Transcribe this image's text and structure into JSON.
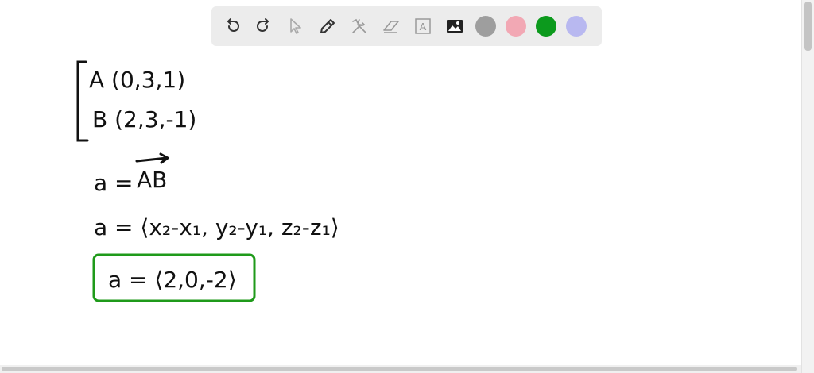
{
  "toolbar": {
    "tools": [
      {
        "name": "undo-icon"
      },
      {
        "name": "redo-icon"
      },
      {
        "name": "pointer-icon"
      },
      {
        "name": "pen-icon"
      },
      {
        "name": "tools-icon"
      },
      {
        "name": "eraser-icon"
      },
      {
        "name": "text-icon",
        "glyph": "A"
      },
      {
        "name": "image-icon"
      }
    ],
    "colors": [
      "#9e9e9e",
      "#f2a8b4",
      "#0c9a1d",
      "#b8b8f0"
    ]
  },
  "whiteboard": {
    "point_a": "A (0,3,1)",
    "point_b": "B (2,3,-1)",
    "vec_def_lhs": "a =",
    "vec_def_rhs": "AB",
    "formula": "a = ⟨x₂-x₁, y₂-y₁, z₂-z₁⟩",
    "result": "a = ⟨2,0,-2⟩",
    "result_box_color": "#1f9a1a"
  }
}
